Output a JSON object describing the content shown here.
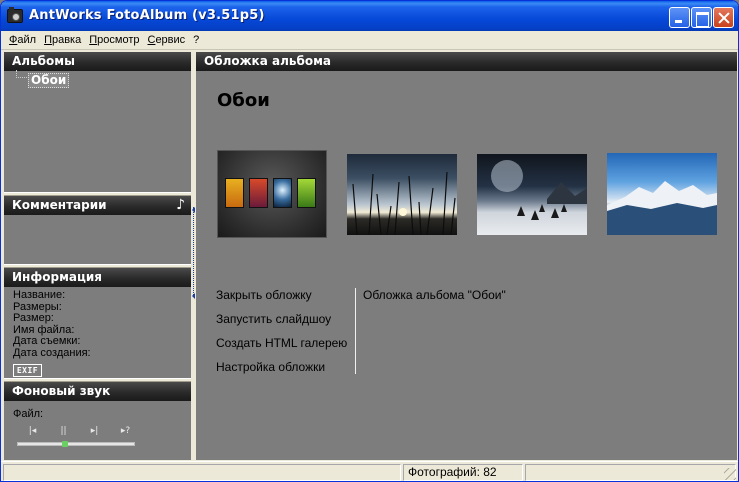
{
  "window": {
    "title": "AntWorks FotoAlbum (v3.51p5)"
  },
  "menu": [
    "Файл",
    "Правка",
    "Просмотр",
    "Сервис",
    "?"
  ],
  "left": {
    "albums": {
      "header": "Альбомы",
      "items": [
        "Обои"
      ]
    },
    "comments": {
      "header": "Комментарии",
      "icon": "music-note-icon"
    },
    "info": {
      "header": "Информация",
      "fields": [
        "Название:",
        "Размеры:",
        "Размер:",
        "Имя файла:",
        "Дата съемки:",
        "Дата создания:"
      ],
      "exif_label": "EXIF"
    },
    "sound": {
      "header": "Фоновый звук",
      "file_label": "Файл:",
      "buttons": [
        "|◂",
        "||",
        "▸|",
        "▸?"
      ],
      "position": 0.4
    }
  },
  "right": {
    "header": "Обложка альбома",
    "album_title": "Обои",
    "actions": [
      "Закрыть обложку",
      "Запустить слайдшоу",
      "Создать HTML галерею",
      "Настройка обложки"
    ],
    "caption": "Обложка альбома \"Обои\""
  },
  "status": {
    "photos": "Фотографий: 82"
  }
}
